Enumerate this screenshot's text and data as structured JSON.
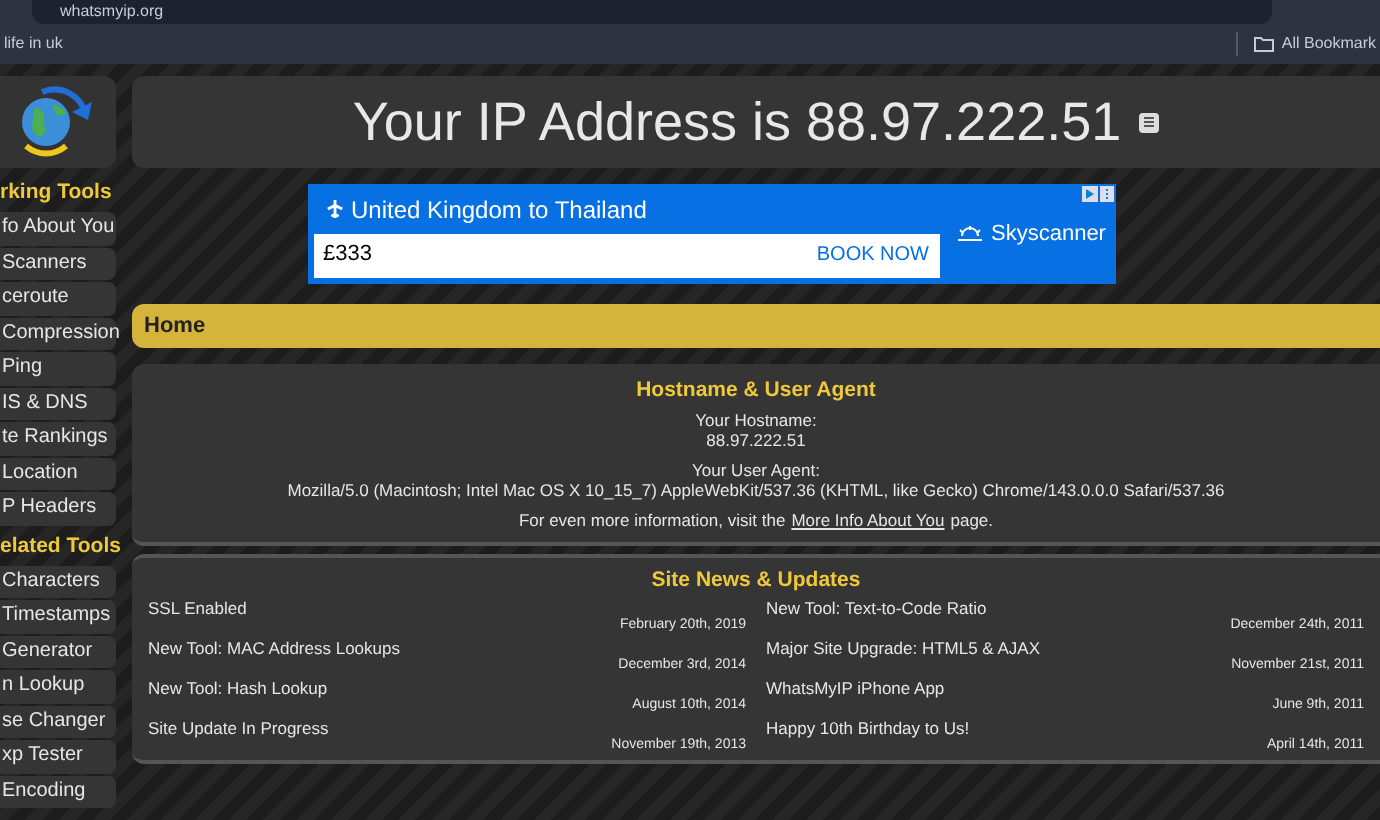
{
  "browser": {
    "url": "whatsmyip.org",
    "bookmarks": [
      "life in uk"
    ],
    "all_bookmarks": "All Bookmark"
  },
  "sidebar": [
    {
      "heading": "rking Tools",
      "items": [
        "fo About You",
        "Scanners",
        "ceroute",
        "Compression",
        "Ping",
        "IS & DNS",
        "te Rankings",
        "Location",
        "P Headers"
      ]
    },
    {
      "heading": "elated Tools",
      "items": [
        "Characters",
        "Timestamps",
        "Generator",
        "n Lookup",
        "se Changer",
        "xp Tester",
        "Encoding"
      ]
    }
  ],
  "title": "Your IP Address is 88.97.222.51",
  "ad": {
    "route": "United Kingdom to Thailand",
    "price": "£333",
    "cta": "BOOK NOW",
    "brand": "Skyscanner"
  },
  "breadcrumb": "Home",
  "hostname_section": {
    "heading": "Hostname & User Agent",
    "hostname_label": "Your Hostname:",
    "hostname": "88.97.222.51",
    "agent_label": "Your User Agent:",
    "agent": "Mozilla/5.0 (Macintosh; Intel Mac OS X 10_15_7) AppleWebKit/537.36 (KHTML, like Gecko) Chrome/143.0.0.0 Safari/537.36",
    "more_before": "For even more information, visit the",
    "more_link": "More Info About You",
    "more_after": "page."
  },
  "news": {
    "heading": "Site News & Updates",
    "items": [
      {
        "title": "SSL Enabled",
        "date": "February 20th, 2019"
      },
      {
        "title": "New Tool: Text-to-Code Ratio",
        "date": "December 24th, 2011"
      },
      {
        "title": "New Tool: MAC Address Lookups",
        "date": "December 3rd, 2014"
      },
      {
        "title": "Major Site Upgrade: HTML5 & AJAX",
        "date": "November 21st, 2011"
      },
      {
        "title": "New Tool: Hash Lookup",
        "date": "August 10th, 2014"
      },
      {
        "title": "WhatsMyIP iPhone App",
        "date": "June 9th, 2011"
      },
      {
        "title": "Site Update In Progress",
        "date": "November 19th, 2013"
      },
      {
        "title": "Happy 10th Birthday to Us!",
        "date": "April 14th, 2011"
      }
    ]
  }
}
